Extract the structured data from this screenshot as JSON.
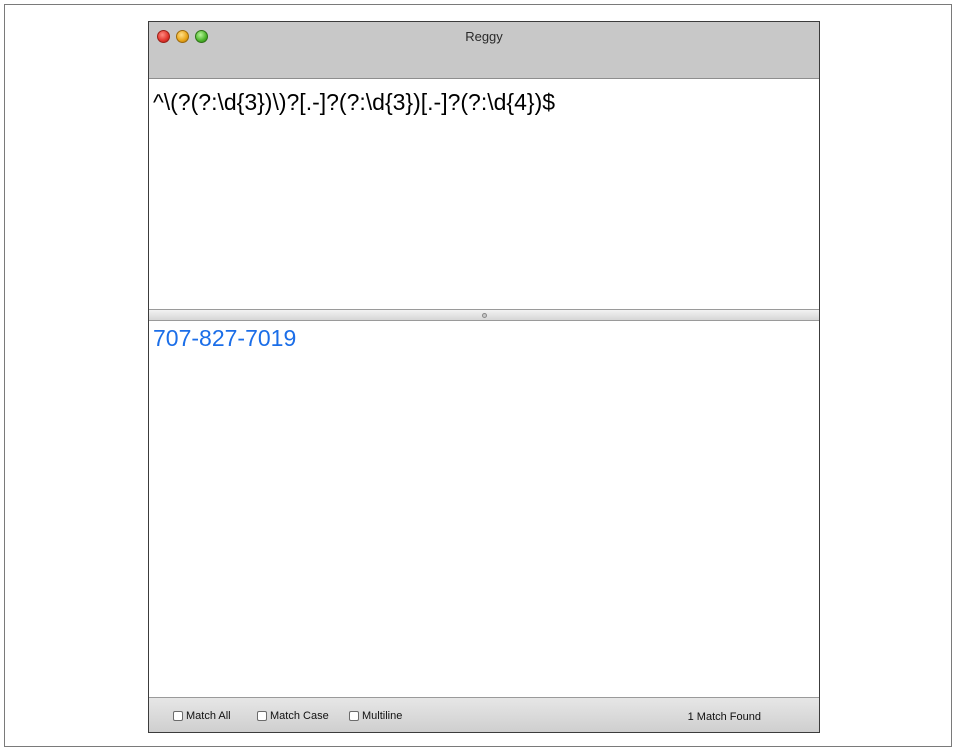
{
  "window": {
    "title": "Reggy"
  },
  "pattern": {
    "value": "^\\(?(?:\\d{3})\\)?[.-]?(?:\\d{3})[.-]?(?:\\d{4})$"
  },
  "test": {
    "value": "707-827-7019",
    "match_color": "#1b6ee8"
  },
  "options": {
    "match_all": {
      "label": "Match All",
      "checked": false
    },
    "match_case": {
      "label": "Match Case",
      "checked": false
    },
    "multiline": {
      "label": "Multiline",
      "checked": false
    }
  },
  "status": {
    "text": "1 Match Found"
  },
  "icons": {
    "close": "close-icon",
    "minimize": "minimize-icon",
    "zoom": "zoom-icon",
    "splitter": "splitter-grip-icon"
  }
}
